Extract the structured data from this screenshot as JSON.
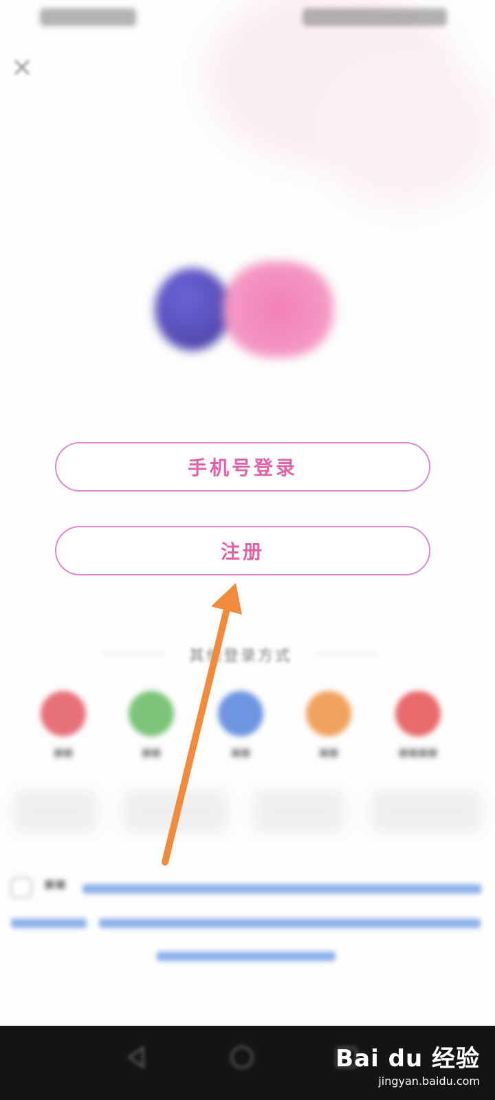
{
  "login": {
    "phone_button": "手机号登录",
    "register_button": "注册"
  },
  "other_login": {
    "heading": "其他登录方式",
    "providers": [
      {
        "icon": "weibo-icon",
        "color": "#e8707a"
      },
      {
        "icon": "wechat-icon",
        "color": "#7cc47a"
      },
      {
        "icon": "qq-icon",
        "color": "#6e96e0"
      },
      {
        "icon": "taobao-icon",
        "color": "#f0a35e"
      },
      {
        "icon": "netease-icon",
        "color": "#e86a6a"
      }
    ]
  },
  "colors": {
    "accent_pink": "#e061a6",
    "button_border": "#d98ad0",
    "annotation_arrow": "#f08a3c"
  },
  "watermark": {
    "logo": "Bai du 经验",
    "url": "jingyan.baidu.com"
  }
}
